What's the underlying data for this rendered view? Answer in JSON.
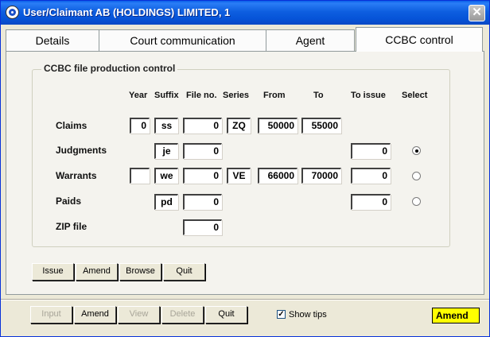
{
  "window": {
    "title": "User/Claimant AB (HOLDINGS) LIMITED, 1",
    "close_glyph": "✕"
  },
  "tabs": [
    {
      "label": "Details"
    },
    {
      "label": "Court communication"
    },
    {
      "label": "Agent"
    },
    {
      "label": "CCBC control",
      "active": true
    }
  ],
  "group": {
    "title": "CCBC file production control",
    "headers": {
      "year": "Year",
      "suffix": "Suffix",
      "file_no": "File no.",
      "series": "Series",
      "from": "From",
      "to": "To",
      "to_issue": "To issue",
      "select": "Select"
    },
    "rows": {
      "claims": {
        "label": "Claims",
        "year": "0",
        "suffix": "ss",
        "file_no": "0",
        "series": "ZQ",
        "from": "50000",
        "to": "55000"
      },
      "judgments": {
        "label": "Judgments",
        "suffix": "je",
        "file_no": "0",
        "to_issue": "0",
        "selected": true
      },
      "warrants": {
        "label": "Warrants",
        "year": "",
        "suffix": "we",
        "file_no": "0",
        "series": "VE",
        "from": "66000",
        "to": "70000",
        "to_issue": "0",
        "selected": false
      },
      "paids": {
        "label": "Paids",
        "suffix": "pd",
        "file_no": "0",
        "to_issue": "0",
        "selected": false
      },
      "zip": {
        "label": "ZIP file",
        "file_no": "0"
      }
    }
  },
  "panel_buttons": {
    "issue": "Issue",
    "amend": "Amend",
    "browse": "Browse",
    "quit": "Quit"
  },
  "bottom_bar": {
    "input": "Input",
    "amend": "Amend",
    "view": "View",
    "delete": "Delete",
    "quit": "Quit",
    "show_tips_label": "Show tips",
    "show_tips_checked": true,
    "checkbox_glyph": "✓",
    "mode": "Amend"
  },
  "colors": {
    "title_bar": "#0654d8",
    "mode_background": "#ffff00"
  }
}
